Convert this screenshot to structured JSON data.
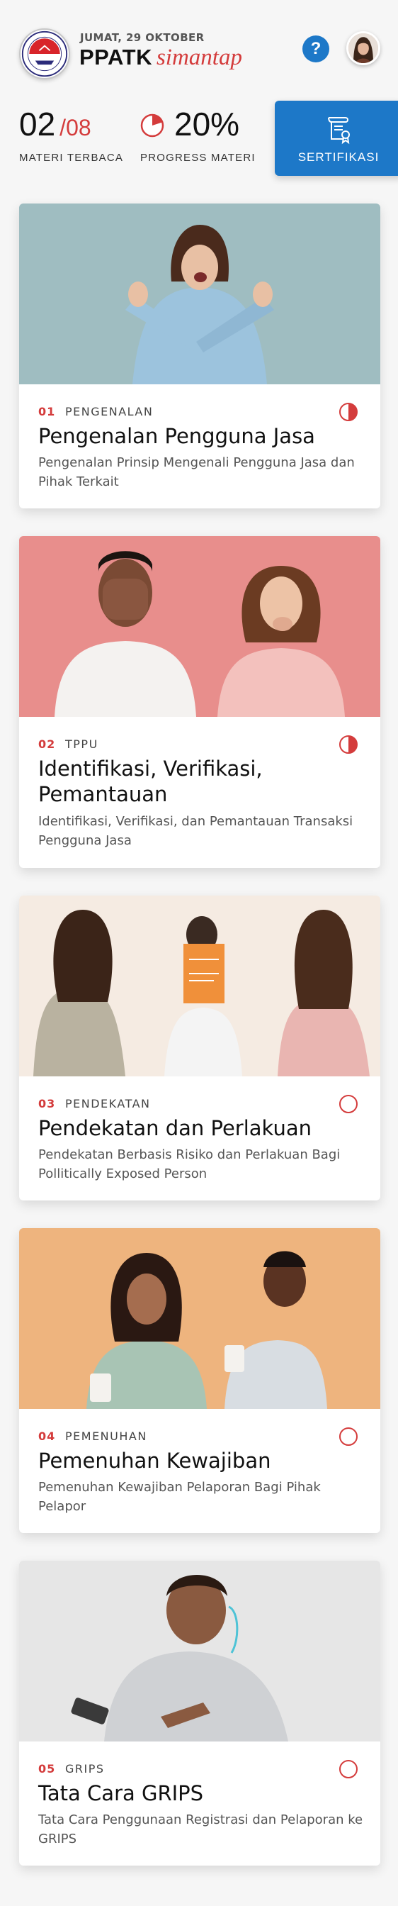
{
  "header": {
    "date": "JUMAT, 29 OKTOBER",
    "brand_bold": "PPATK",
    "brand_italic": "simantap",
    "help_label": "?",
    "logo_icon": "ppatk-emblem-icon",
    "avatar_icon": "user-avatar"
  },
  "stats": {
    "materi_read": "02",
    "materi_total": "/08",
    "materi_label": "MATERI TERBACA",
    "progress_value": "20%",
    "progress_fraction": 0.2,
    "progress_label": "PROGRESS MATERI",
    "certificate_label": "SERTIFIKASI"
  },
  "colors": {
    "accent_red": "#d43c3c",
    "primary_blue": "#1d78c8",
    "background": "#f6f6f6"
  },
  "cards": [
    {
      "num": "01",
      "tag": "PENGENALAN",
      "title": "Pengenalan Pengguna Jasa",
      "desc": "Pengenalan Prinsip Mengenali Pengguna Jasa dan Pihak Terkait",
      "progress": 0.5
    },
    {
      "num": "02",
      "tag": "TPPU",
      "title": "Identifikasi, Verifikasi, Pemantauan",
      "desc": "Identifikasi, Verifikasi, dan Pemantauan Transaksi Pengguna Jasa",
      "progress": 0.5
    },
    {
      "num": "03",
      "tag": "PENDEKATAN",
      "title": "Pendekatan dan Perlakuan",
      "desc": "Pendekatan Berbasis Risiko dan Perlakuan Bagi Pollitically Exposed Person",
      "progress": 0
    },
    {
      "num": "04",
      "tag": "PEMENUHAN",
      "title": "Pemenuhan Kewajiban",
      "desc": "Pemenuhan Kewajiban Pelaporan Bagi Pihak Pelapor",
      "progress": 0
    },
    {
      "num": "05",
      "tag": "GRIPS",
      "title": "Tata Cara GRIPS",
      "desc": "Tata Cara Penggunaan Registrasi dan Pelaporan ke GRIPS",
      "progress": 0
    }
  ]
}
